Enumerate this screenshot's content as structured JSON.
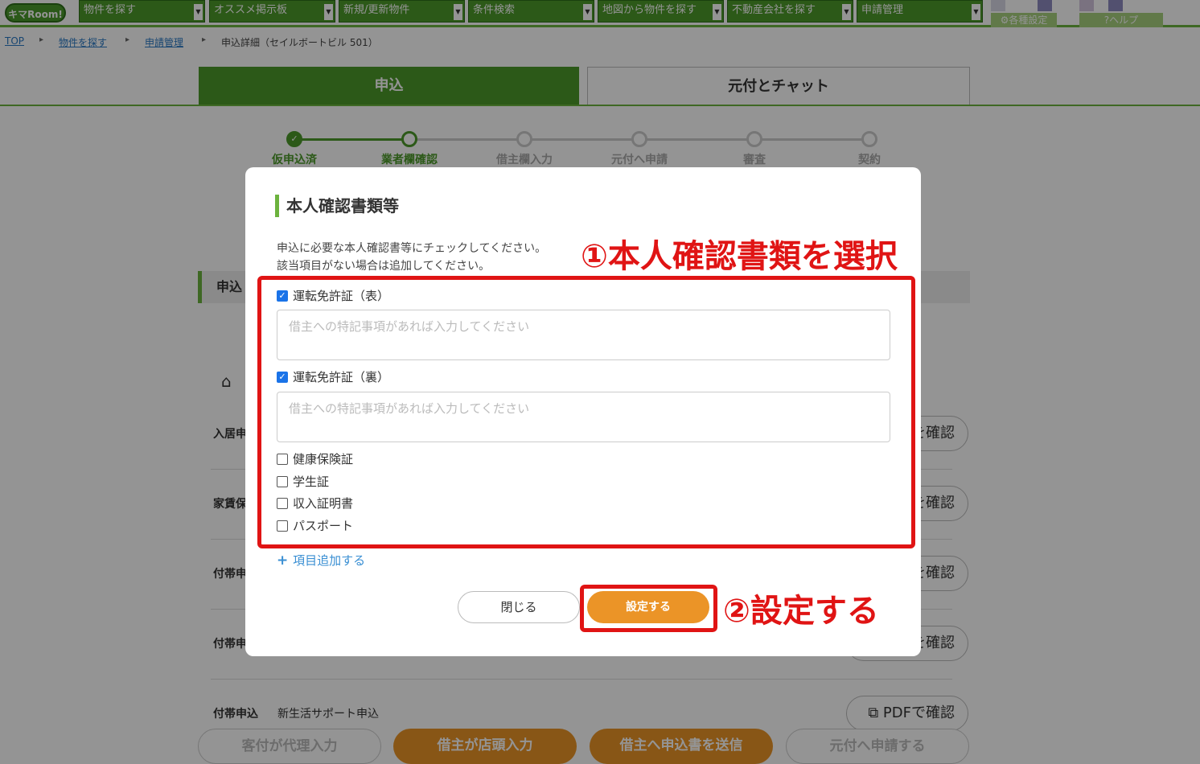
{
  "nav": {
    "logo": "キマRoom!",
    "items": [
      "物件を探す",
      "オススメ掲示板",
      "新規/更新物件",
      "条件検索",
      "地図から物件を探す",
      "不動産会社を探す",
      "申請管理"
    ],
    "arrow": "▼",
    "settings": "各種設定",
    "help": "ヘルプ"
  },
  "breadcrumb": {
    "top": "TOP",
    "search": "物件を探す",
    "manage": "申請管理",
    "current": "申込詳細（セイルボートビル 501）",
    "sep": "▸"
  },
  "tabs": {
    "apply": "申込",
    "chat": "元付とチャット"
  },
  "steps": [
    "仮申込済",
    "業者欄確認",
    "借主欄入力",
    "元付へ申請",
    "審査",
    "契約"
  ],
  "bg": {
    "section_title": "申込",
    "rows": [
      {
        "label": "入居申",
        "btn": "を確認"
      },
      {
        "label": "家賃保",
        "btn": "を確認"
      },
      {
        "label": "付帯申",
        "btn": "を確認"
      },
      {
        "label": "付帯申",
        "btn": "を確認"
      },
      {
        "label": "付帯申込",
        "value": "新生活サポート申込",
        "btn": "PDFで確認"
      }
    ],
    "bottom": [
      "客付が代理入力",
      "借主が店頭入力",
      "借主へ申込書を送信",
      "元付へ申請する"
    ]
  },
  "modal": {
    "title": "本人確認書類等",
    "desc1": "申込に必要な本人確認書等にチェックしてください。",
    "desc2": "該当項目がない場合は追加してください。",
    "items": [
      {
        "label": "運転免許証（表）",
        "checked": true,
        "placeholder": "借主への特記事項があれば入力してください"
      },
      {
        "label": "運転免許証（裏）",
        "checked": true,
        "placeholder": "借主への特記事項があれば入力してください"
      },
      {
        "label": "健康保険証",
        "checked": false
      },
      {
        "label": "学生証",
        "checked": false
      },
      {
        "label": "収入証明書",
        "checked": false
      },
      {
        "label": "パスポート",
        "checked": false
      }
    ],
    "add": "項目追加する",
    "close": "閉じる",
    "set": "設定する"
  },
  "annotations": {
    "a1": "①本人確認書類を選択",
    "a2": "②設定する"
  },
  "colors": {
    "green": "#4c9a2a",
    "orange": "#eb9427",
    "red": "#e01414",
    "blue": "#1a73e8"
  }
}
